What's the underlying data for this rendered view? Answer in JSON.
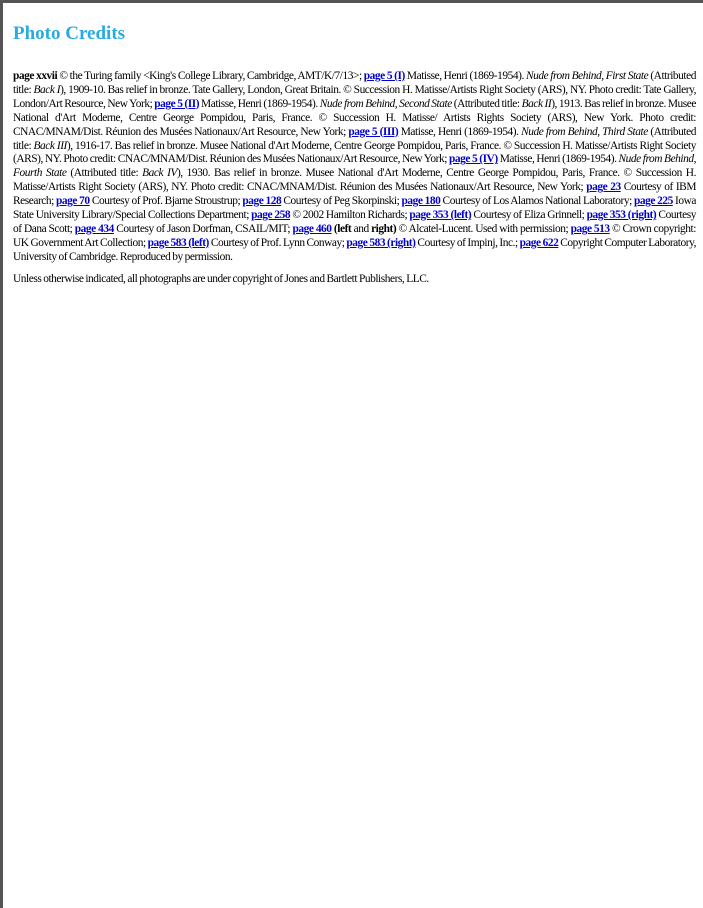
{
  "title": "Photo Credits",
  "credits": [
    {
      "b": "page xxvii"
    },
    {
      "t": " © the Turing family <King's College Library, Cambridge, AMT/K/7/13>; "
    },
    {
      "a": "page 5 (I)"
    },
    {
      "t": " Matisse, Henri (1869-1954). "
    },
    {
      "i": "Nude from Behind, First State"
    },
    {
      "t": " (Attributed title: "
    },
    {
      "i": "Back I"
    },
    {
      "t": "), 1909-10. Bas relief in bronze. Tate Gallery, London, Great Britain. © Succession H. Matisse/Artists Right Society (ARS), NY. Photo credit: Tate Gallery, London/Art Resource, New York; "
    },
    {
      "a": "page 5 (II)"
    },
    {
      "t": " Matisse, Henri (1869-1954). "
    },
    {
      "i": "Nude from Behind, Second State"
    },
    {
      "t": " (Attributed title: "
    },
    {
      "i": "Back II"
    },
    {
      "t": "), 1913. Bas relief in bronze. Musee National d'Art Moderne, Centre George Pompidou, Paris, France. © Succession H. Matisse/ Artists Rights Society (ARS), New York. Photo credit: CNAC/MNAM/Dist. Réunion des Musées Nationaux/Art Resource, New York; "
    },
    {
      "a": "page 5 (III)"
    },
    {
      "t": " Matisse, Henri (1869-1954). "
    },
    {
      "i": "Nude from Behind, Third State"
    },
    {
      "t": " (Attributed title: "
    },
    {
      "i": "Back III"
    },
    {
      "t": "), 1916-17. Bas relief in bronze. Musee National d'Art Moderne, Centre George Pompidou, Paris, France. © Succession H. Matisse/Artists Right Society (ARS), NY. Photo credit: CNAC/MNAM/Dist. Réunion des Musées Nationaux/Art Resource, New York; "
    },
    {
      "a": "page 5 (IV)"
    },
    {
      "t": " Matisse, Henri (1869-1954). "
    },
    {
      "i": "Nude from Behind, Fourth State"
    },
    {
      "t": " (Attributed title: "
    },
    {
      "i": "Back IV"
    },
    {
      "t": "), 1930. Bas relief in bronze. Musee National d'Art Moderne, Centre George Pompidou, Paris, France. © Succession H. Matisse/Artists Right Society (ARS), NY. Photo credit: CNAC/MNAM/Dist. Réunion des Musées Nationaux/Art Resource, New York; "
    },
    {
      "a": "page 23"
    },
    {
      "t": " Courtesy of IBM Research; "
    },
    {
      "a": "page 70"
    },
    {
      "t": " Courtesy of Prof. Bjarne Stroustrup; "
    },
    {
      "a": "page 128"
    },
    {
      "t": " Courtesy of Peg Skorpinski; "
    },
    {
      "a": "page 180"
    },
    {
      "t": " Courtesy of Los Alamos National Laboratory; "
    },
    {
      "a": "page 225"
    },
    {
      "t": " Iowa State University Library/Special Collections Department; "
    },
    {
      "a": "page 258"
    },
    {
      "t": " © 2002 Hamilton Richards; "
    },
    {
      "a": "page 353 (left)"
    },
    {
      "t": " Courtesy of Eliza Grinnell; "
    },
    {
      "a": "page 353 (right)"
    },
    {
      "t": " Courtesy of Dana Scott; "
    },
    {
      "a": "page 434"
    },
    {
      "t": " Courtesy of Jason Dorfman, CSAIL/MIT; "
    },
    {
      "a": "page 460"
    },
    {
      "t": " "
    },
    {
      "b": "(left"
    },
    {
      "t": " and "
    },
    {
      "b": "right)"
    },
    {
      "t": " © Alcatel-Lucent. Used with permission; "
    },
    {
      "a": "page 513"
    },
    {
      "t": " © Crown copyright: UK Government Art Collection; "
    },
    {
      "a": "page 583 (left)"
    },
    {
      "t": " Courtesy of Prof. Lynn Conway; "
    },
    {
      "a": "page 583 (right)"
    },
    {
      "t": " Courtesy of Impinj, Inc.; "
    },
    {
      "a": "page 622"
    },
    {
      "t": " Copyright Computer Laboratory, University of Cambridge. Reproduced by permission."
    }
  ],
  "note": "Unless otherwise indicated, all photographs are under copyright of Jones and Bartlett Publishers, LLC."
}
